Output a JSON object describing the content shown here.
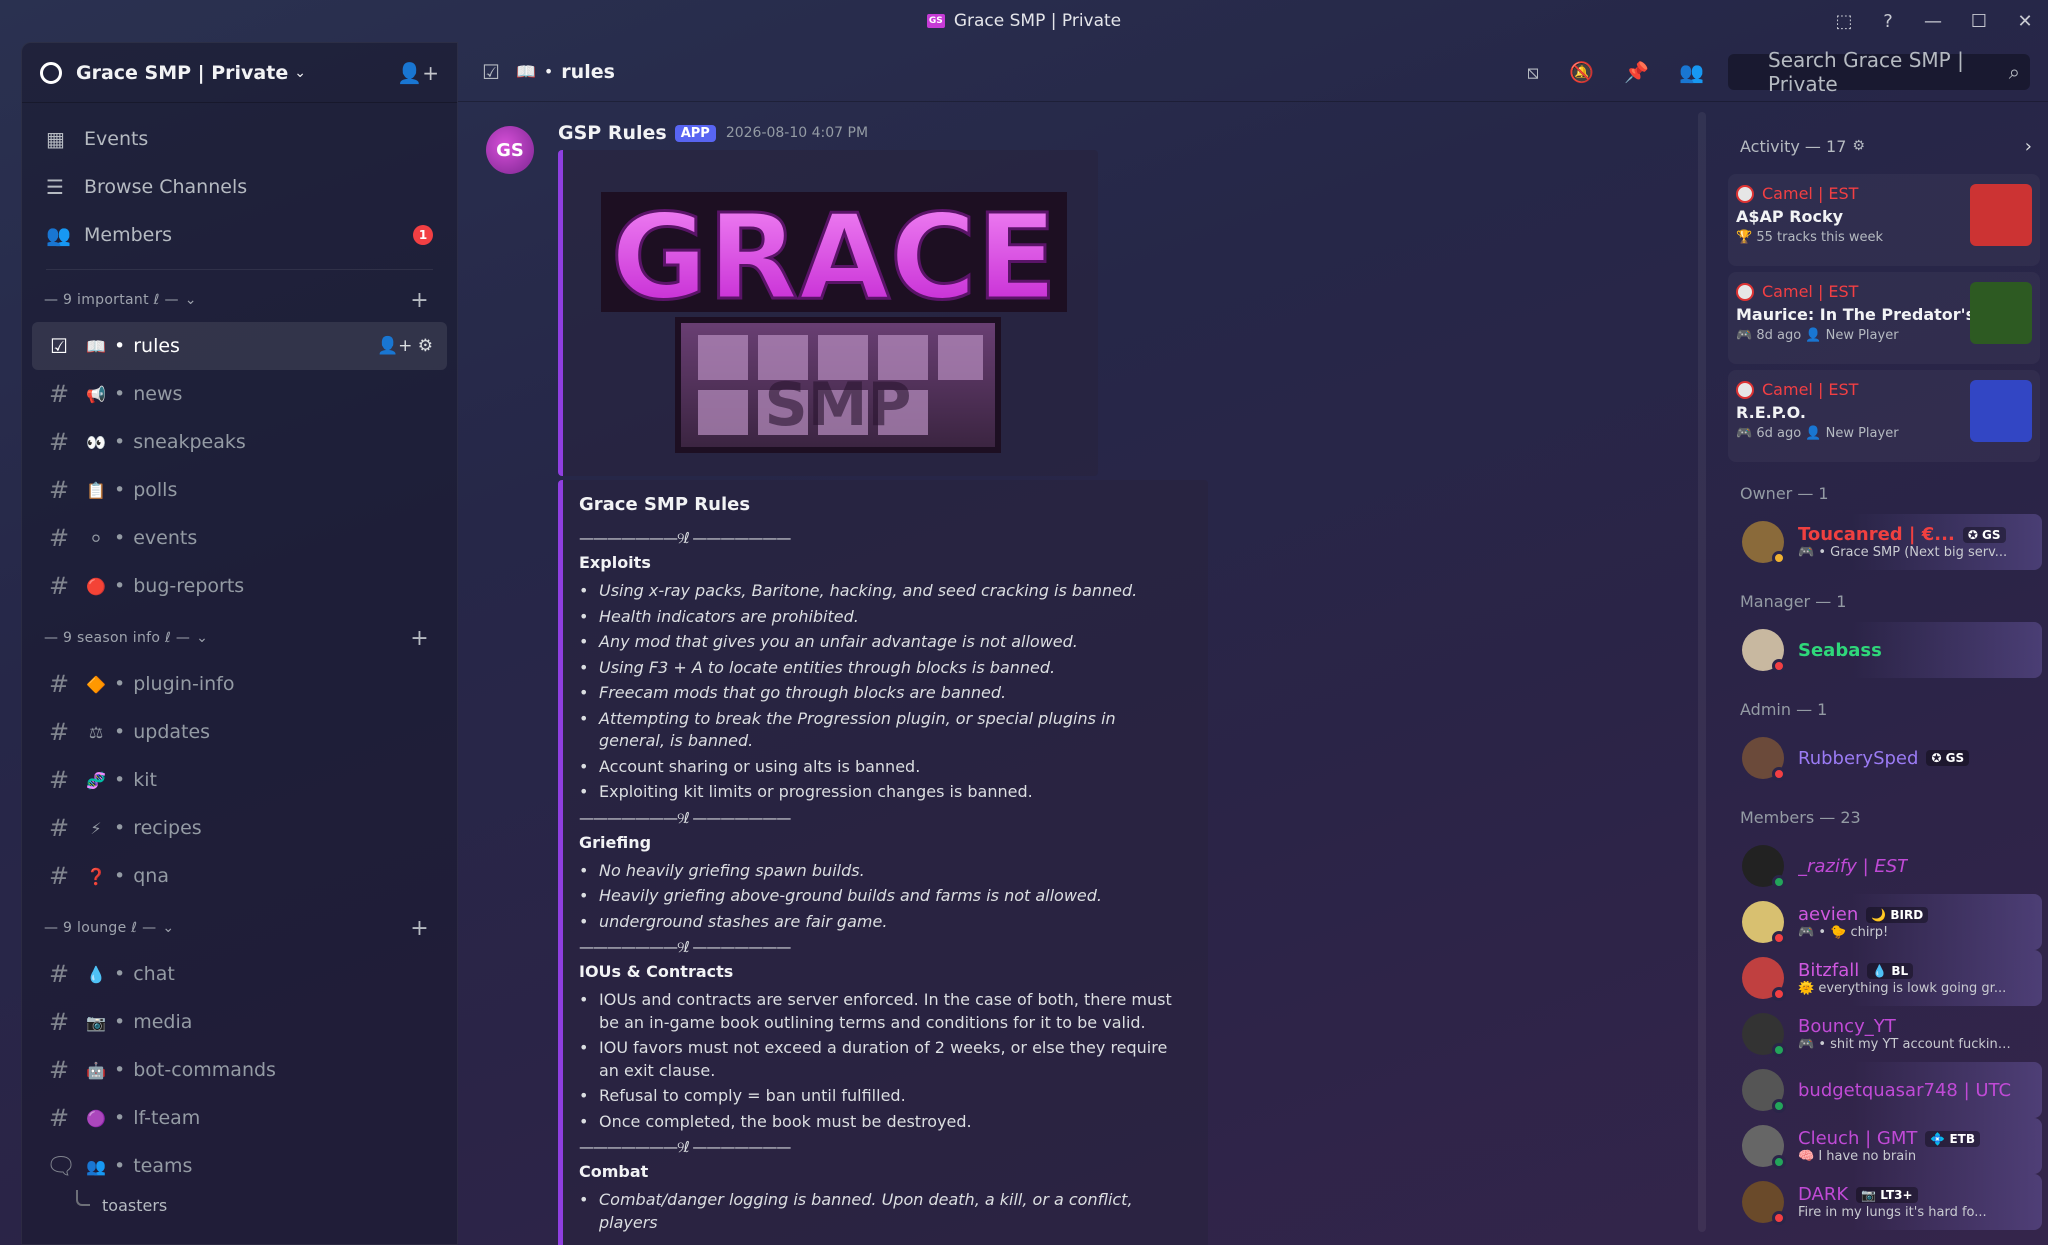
{
  "window": {
    "title": "Grace SMP | Private",
    "logo_text": "GS",
    "controls": [
      "⬚",
      "?",
      "—",
      "☐",
      "✕"
    ]
  },
  "server": {
    "name": "Grace SMP | Private"
  },
  "nav": [
    {
      "label": "Events",
      "icon": "calendar-icon"
    },
    {
      "label": "Browse Channels",
      "icon": "browse-icon"
    },
    {
      "label": "Members",
      "icon": "members-icon",
      "badge": "1"
    }
  ],
  "categories": [
    {
      "label": "— 9 important ℓ —",
      "channels": [
        {
          "name": "rules",
          "emoji": "📖",
          "active": true
        },
        {
          "name": "news",
          "emoji": "📢"
        },
        {
          "name": "sneakpeaks",
          "emoji": "👀"
        },
        {
          "name": "polls",
          "emoji": "📋"
        },
        {
          "name": "events",
          "emoji": "⚪"
        },
        {
          "name": "bug-reports",
          "emoji": "🔴"
        }
      ]
    },
    {
      "label": "— 9 season info ℓ —",
      "channels": [
        {
          "name": "plugin-info",
          "emoji": "🔶"
        },
        {
          "name": "updates",
          "emoji": "⚖"
        },
        {
          "name": "kit",
          "emoji": "🧬"
        },
        {
          "name": "recipes",
          "emoji": "⚡"
        },
        {
          "name": "qna",
          "emoji": "❓"
        }
      ]
    },
    {
      "label": "— 9 lounge ℓ —",
      "channels": [
        {
          "name": "chat",
          "emoji": "💧"
        },
        {
          "name": "media",
          "emoji": "📷"
        },
        {
          "name": "bot-commands",
          "emoji": "🤖"
        },
        {
          "name": "lf-team",
          "emoji": "🟣"
        },
        {
          "name": "teams",
          "emoji": "👥"
        }
      ],
      "thread": "toasters"
    }
  ],
  "header": {
    "channel": "rules",
    "search_placeholder": "Search Grace SMP | Private"
  },
  "message": {
    "avatar_text": "GS",
    "author": "GSP Rules",
    "app_tag": "APP",
    "timestamp": "2026-08-10 4:07 PM",
    "logo_top": "GRACE",
    "logo_bottom": "SMP",
    "embed_title": "Grace SMP Rules",
    "divider": "———————୨ℓ ———————",
    "sections": [
      {
        "title": "Exploits",
        "rules": [
          {
            "text": "Using x-ray packs, Baritone, hacking, and seed cracking is banned.",
            "italic": true
          },
          {
            "text": "Health indicators are prohibited.",
            "italic": true
          },
          {
            "text": "Any mod that gives you an unfair advantage is not allowed.",
            "italic": true
          },
          {
            "text": "Using F3 + A to locate entities through blocks is banned.",
            "italic": true
          },
          {
            "text": "Freecam mods that go through blocks are banned.",
            "italic": true
          },
          {
            "text": "Attempting to break the Progression plugin, or special plugins in general, is banned.",
            "italic": true
          },
          {
            "text": "Account sharing or using alts is banned.",
            "italic": false
          },
          {
            "text": "Exploiting kit limits or progression changes is banned.",
            "italic": false
          }
        ]
      },
      {
        "title": "Griefing",
        "rules": [
          {
            "text": "No heavily griefing spawn builds.",
            "italic": true
          },
          {
            "text": "Heavily griefing above-ground builds and farms is not allowed.",
            "italic": true
          },
          {
            "text": "underground stashes are fair game.",
            "italic": true
          }
        ]
      },
      {
        "title": "IOUs & Contracts",
        "rules": [
          {
            "text": "IOUs and contracts are server enforced. In the case of both, there must be an in-game book outlining terms and conditions for it to be valid.",
            "italic": false
          },
          {
            "text": "IOU favors must not exceed a duration of 2 weeks, or else they require an exit clause.",
            "italic": false
          },
          {
            "text": "Refusal to comply = ban until fulfilled.",
            "italic": false
          },
          {
            "text": "Once completed, the book must be destroyed.",
            "italic": false
          }
        ]
      },
      {
        "title": "Combat",
        "rules": [
          {
            "text": "Combat/danger logging is banned. Upon death, a kill, or a conflict, players",
            "italic": true
          }
        ]
      }
    ]
  },
  "activity": {
    "title": "Activity — 17",
    "items": [
      {
        "user": "Camel | EST",
        "what": "A$AP Rocky",
        "meta1": "55 tracks this week",
        "meta2": "",
        "icon": "trophy-icon",
        "art": "#c33"
      },
      {
        "user": "Camel | EST",
        "what": "Maurice: In The Predator's ...",
        "meta1": "8d ago",
        "meta2": "New Player",
        "icon": "gamepad-icon",
        "art": "#2d5a22"
      },
      {
        "user": "Camel | EST",
        "what": "R.E.P.O.",
        "meta1": "6d ago",
        "meta2": "New Player",
        "icon": "gamepad-icon",
        "art": "#3246c4"
      }
    ]
  },
  "groups": [
    {
      "label": "Owner — 1",
      "members": [
        {
          "name": "Toucanred | €...",
          "color": "#f04040",
          "tag": "✪ GS",
          "sub": "🎮 • Grace SMP (Next big serv...",
          "status": "#f0b232",
          "avatar": "#8a6a3a",
          "banner": true
        }
      ]
    },
    {
      "label": "Manager — 1",
      "members": [
        {
          "name": "Seabass",
          "color": "#2fd77a",
          "tag": "",
          "sub": "",
          "status": "#f23f43",
          "avatar": "#c8b8a0",
          "banner": true
        }
      ]
    },
    {
      "label": "Admin — 1",
      "members": [
        {
          "name": "RubberySped",
          "color": "#9b7bf5",
          "tag": "✪ GS",
          "sub": "",
          "status": "#f23f43",
          "avatar": "#6b4a3a",
          "banner": false
        }
      ]
    },
    {
      "label": "Members — 23",
      "members": [
        {
          "name": "_razify | EST",
          "color": "#c04ad6",
          "tag": "",
          "sub": "",
          "status": "#23a55a",
          "avatar": "#222",
          "banner": false,
          "italic": true
        },
        {
          "name": "aevien",
          "color": "#d058e0",
          "tag": "🌙 BIRD",
          "sub": "🎮 • 🐤 chirp!",
          "status": "#f23f43",
          "avatar": "#d8c070",
          "banner": true
        },
        {
          "name": "Bitzfall",
          "color": "#d058e0",
          "tag": "💧 BL",
          "sub": "🌞 everything is lowk going gr...",
          "status": "#f23f43",
          "avatar": "#c04040",
          "banner": true
        },
        {
          "name": "Bouncy_YT",
          "color": "#c04ad6",
          "tag": "",
          "sub": "🎮 • shit my YT account fucking gone",
          "status": "#23a55a",
          "avatar": "#333",
          "banner": false
        },
        {
          "name": "budgetquasar748 | UTC",
          "color": "#c04ad6",
          "tag": "",
          "sub": "",
          "status": "#23a55a",
          "avatar": "#555",
          "banner": true
        },
        {
          "name": "Cleuch | GMT",
          "color": "#c04ad6",
          "tag": "💠 ETB",
          "sub": "🧠 I have no brain",
          "status": "#23a55a",
          "avatar": "#666",
          "banner": true
        },
        {
          "name": "DARK",
          "color": "#c04ad6",
          "tag": "📷 LT3+",
          "sub": "Fire in my lungs it's hard fo...",
          "status": "#f23f43",
          "avatar": "#6a4a2a",
          "banner": true
        }
      ]
    }
  ]
}
